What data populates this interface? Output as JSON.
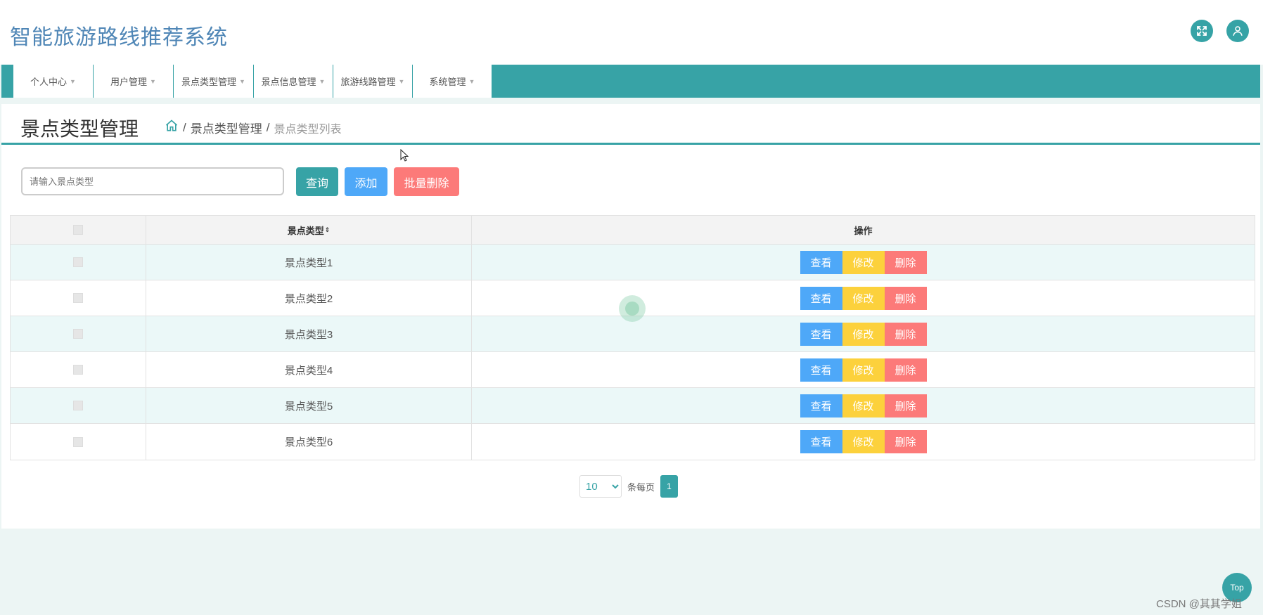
{
  "app": {
    "title": "智能旅游路线推荐系统"
  },
  "header": {
    "icons": [
      "fullscreen-icon",
      "user-icon"
    ],
    "accent": "#37a3a6"
  },
  "nav": {
    "items": [
      {
        "label": "个人中心"
      },
      {
        "label": "用户管理"
      },
      {
        "label": "景点类型管理"
      },
      {
        "label": "景点信息管理"
      },
      {
        "label": "旅游线路管理"
      },
      {
        "label": "系统管理"
      }
    ]
  },
  "page": {
    "title": "景点类型管理",
    "breadcrumb": {
      "sep": "/",
      "parent": "景点类型管理",
      "current": "景点类型列表"
    }
  },
  "toolbar": {
    "search_placeholder": "请输入景点类型",
    "search_label": "查询",
    "add_label": "添加",
    "batch_delete_label": "批量删除"
  },
  "table": {
    "headers": {
      "type": "景点类型",
      "sort": "⇕",
      "ops": "操作"
    },
    "rows": [
      {
        "type": "景点类型1"
      },
      {
        "type": "景点类型2"
      },
      {
        "type": "景点类型3"
      },
      {
        "type": "景点类型4"
      },
      {
        "type": "景点类型5"
      },
      {
        "type": "景点类型6"
      }
    ],
    "actions": {
      "view": "查看",
      "edit": "修改",
      "delete": "删除"
    }
  },
  "pagination": {
    "page_size": "10",
    "per_page_label": "条每页",
    "current_page": "1"
  },
  "top_button": "Top",
  "watermark": "CSDN @其其学姐"
}
